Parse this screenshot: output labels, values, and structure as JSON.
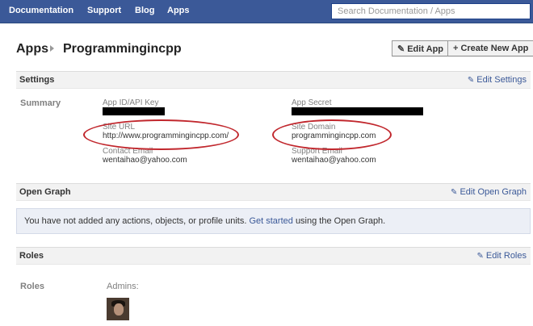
{
  "nav": {
    "links": [
      "Documentation",
      "Support",
      "Blog",
      "Apps"
    ],
    "search_placeholder": "Search Documentation / Apps"
  },
  "header": {
    "section": "Apps",
    "app_name": "Programmingincpp",
    "edit_app": "Edit App",
    "create_app": "Create New App"
  },
  "settings": {
    "title": "Settings",
    "edit": "Edit Settings",
    "summary_label": "Summary",
    "app_id_label": "App ID/API Key",
    "app_secret_label": "App Secret",
    "site_url_label": "Site URL",
    "site_url": "http://www.programmingincpp.com/",
    "site_domain_label": "Site Domain",
    "site_domain": "programmingincpp.com",
    "contact_email_label": "Contact Email",
    "contact_email": "wentaihao@yahoo.com",
    "support_email_label": "Support Email",
    "support_email": "wentaihao@yahoo.com"
  },
  "open_graph": {
    "title": "Open Graph",
    "edit": "Edit Open Graph",
    "notice_before": "You have not added any actions, objects, or profile units.",
    "notice_link": "Get started",
    "notice_after": "using the Open Graph."
  },
  "roles": {
    "title": "Roles",
    "edit": "Edit Roles",
    "label": "Roles",
    "admins_label": "Admins:"
  },
  "colors": {
    "brand": "#3b5998",
    "highlight": "#c1272d"
  }
}
